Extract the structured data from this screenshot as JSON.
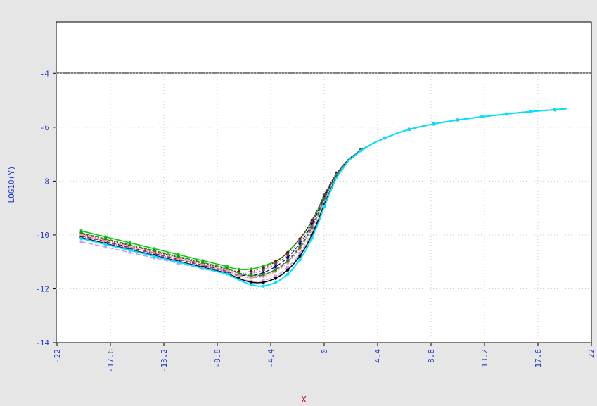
{
  "chart_data": {
    "type": "line",
    "title": "",
    "xlabel": "X",
    "ylabel": "LOG10(Y)",
    "xlim": [
      -22,
      22
    ],
    "ylim": [
      -14,
      -3
    ],
    "xticks": [
      -22,
      -17.6,
      -13.2,
      -8.8,
      -4.4,
      0,
      4.4,
      8.8,
      13.2,
      17.6,
      22
    ],
    "xtick_labels": [
      "-22",
      "-17.6",
      "-13.2",
      "-8.8",
      "-4.4",
      "0",
      "4.4",
      "8.8",
      "13.2",
      "17.6",
      "22"
    ],
    "yticks": [
      -14,
      -12,
      -10,
      -8,
      -6,
      -4
    ],
    "ytick_labels": [
      "-14",
      "-12",
      "-10",
      "-8",
      "-6",
      "-4"
    ],
    "grid": true,
    "legend": "none",
    "x": [
      -20,
      -19,
      -18,
      -17,
      -16,
      -15,
      -14,
      -13,
      -12,
      -11,
      -10,
      -9,
      -8,
      -7.5,
      -7,
      -6.5,
      -6,
      -5.5,
      -5,
      -4.5,
      -4,
      -3.5,
      -3,
      -2.5,
      -2,
      -1.5,
      -1,
      -0.5,
      0,
      0.5,
      1,
      2,
      3,
      4,
      5,
      6,
      7,
      8,
      9,
      10,
      11,
      12,
      13,
      14,
      15,
      16,
      17,
      18,
      19,
      20
    ],
    "series": [
      {
        "color": "#00cc00",
        "marker": "circle",
        "dash": "solid",
        "width": 1.6,
        "values": [
          -9.85,
          -9.96,
          -10.07,
          -10.18,
          -10.29,
          -10.4,
          -10.51,
          -10.62,
          -10.73,
          -10.84,
          -10.95,
          -11.06,
          -11.17,
          -11.24,
          -11.28,
          -11.29,
          -11.27,
          -11.22,
          -11.15,
          -11.07,
          -10.98,
          -10.85,
          -10.65,
          -10.4,
          -10.15,
          -9.85,
          -9.5,
          -9.05,
          -8.55,
          -8.15,
          -7.75,
          -7.2,
          -6.85,
          -6.6,
          -6.4,
          -6.22,
          -6.08,
          -5.97,
          -5.88,
          -5.8,
          -5.73,
          -5.67,
          -5.61,
          -5.56,
          -5.51,
          -5.46,
          -5.42,
          -5.38,
          -5.35,
          -5.31
        ]
      },
      {
        "color": "#8b0000",
        "marker": "circle",
        "dash": "2,2",
        "width": 1.2,
        "values": [
          -9.95,
          -10.06,
          -10.17,
          -10.28,
          -10.39,
          -10.5,
          -10.61,
          -10.72,
          -10.83,
          -10.94,
          -11.05,
          -11.16,
          -11.27,
          -11.33,
          -11.37,
          -11.38,
          -11.36,
          -11.3,
          -11.22,
          -11.12,
          -11.0,
          -10.85,
          -10.66,
          -10.42,
          -10.15,
          -9.83,
          -9.45,
          -9.0,
          -8.5,
          -8.1,
          -7.7,
          -7.18,
          -6.84,
          -6.6,
          -6.4,
          -6.22,
          -6.08,
          -5.97,
          -5.88,
          -5.8,
          -5.73,
          -5.67,
          -5.61,
          -5.56,
          -5.51,
          -5.46,
          -5.42,
          -5.38,
          -5.35,
          -5.31
        ]
      },
      {
        "color": "#555555",
        "marker": "circle",
        "dash": "1,2",
        "width": 1.2,
        "values": [
          -9.98,
          -10.09,
          -10.2,
          -10.31,
          -10.42,
          -10.53,
          -10.64,
          -10.75,
          -10.86,
          -10.97,
          -11.08,
          -11.19,
          -11.3,
          -11.37,
          -11.42,
          -11.44,
          -11.43,
          -11.38,
          -11.3,
          -11.2,
          -11.08,
          -10.93,
          -10.74,
          -10.5,
          -10.22,
          -9.9,
          -9.52,
          -9.06,
          -8.55,
          -8.13,
          -7.72,
          -7.19,
          -6.85,
          -6.6,
          -6.4,
          -6.22,
          -6.08,
          -5.97,
          -5.88,
          -5.8,
          -5.73,
          -5.67,
          -5.61,
          -5.56,
          -5.51,
          -5.46,
          -5.42,
          -5.38,
          -5.35,
          -5.31
        ]
      },
      {
        "color": "#000080",
        "marker": "circle",
        "dash": "6,3",
        "width": 1.2,
        "values": [
          -10.02,
          -10.13,
          -10.24,
          -10.35,
          -10.46,
          -10.57,
          -10.68,
          -10.79,
          -10.9,
          -11.01,
          -11.12,
          -11.23,
          -11.34,
          -11.42,
          -11.48,
          -11.51,
          -11.51,
          -11.47,
          -11.4,
          -11.3,
          -11.18,
          -11.03,
          -10.84,
          -10.6,
          -10.32,
          -10.0,
          -9.6,
          -9.13,
          -8.6,
          -8.17,
          -7.74,
          -7.2,
          -6.85,
          -6.6,
          -6.4,
          -6.22,
          -6.08,
          -5.97,
          -5.88,
          -5.8,
          -5.73,
          -5.67,
          -5.61,
          -5.56,
          -5.51,
          -5.46,
          -5.42,
          -5.38,
          -5.35,
          -5.31
        ]
      },
      {
        "color": "#9932cc",
        "marker": "circle",
        "dash": "4,2,1,2",
        "width": 1.4,
        "values": [
          -10.05,
          -10.16,
          -10.27,
          -10.38,
          -10.49,
          -10.6,
          -10.71,
          -10.82,
          -10.93,
          -11.04,
          -11.15,
          -11.26,
          -11.37,
          -11.46,
          -11.53,
          -11.57,
          -11.58,
          -11.55,
          -11.49,
          -11.4,
          -11.28,
          -11.13,
          -10.94,
          -10.7,
          -10.42,
          -10.09,
          -9.68,
          -9.2,
          -8.65,
          -8.2,
          -7.76,
          -7.21,
          -6.86,
          -6.6,
          -6.4,
          -6.22,
          -6.08,
          -5.97,
          -5.88,
          -5.8,
          -5.73,
          -5.67,
          -5.61,
          -5.56,
          -5.51,
          -5.46,
          -5.42,
          -5.38,
          -5.35,
          -5.31
        ]
      },
      {
        "color": "#ffa07a",
        "marker": "circle",
        "dash": "3,2",
        "width": 1.6,
        "values": [
          -10.0,
          -10.11,
          -10.22,
          -10.33,
          -10.44,
          -10.55,
          -10.66,
          -10.77,
          -10.88,
          -10.99,
          -11.1,
          -11.21,
          -11.32,
          -11.42,
          -11.5,
          -11.56,
          -11.59,
          -11.58,
          -11.54,
          -11.46,
          -11.36,
          -11.22,
          -11.04,
          -10.81,
          -10.53,
          -10.19,
          -9.78,
          -9.28,
          -8.72,
          -8.25,
          -7.79,
          -7.22,
          -6.86,
          -6.6,
          -6.4,
          -6.22,
          -6.08,
          -5.97,
          -5.88,
          -5.8,
          -5.73,
          -5.67,
          -5.61,
          -5.56,
          -5.51,
          -5.46,
          -5.42,
          -5.38,
          -5.35,
          -5.31
        ]
      },
      {
        "color": "#228b22",
        "marker": "circle",
        "dash": "5,2",
        "width": 1.4,
        "values": [
          -9.92,
          -10.03,
          -10.14,
          -10.25,
          -10.36,
          -10.47,
          -10.58,
          -10.69,
          -10.8,
          -10.91,
          -11.02,
          -11.13,
          -11.24,
          -11.34,
          -11.42,
          -11.48,
          -11.51,
          -11.51,
          -11.47,
          -11.4,
          -11.3,
          -11.16,
          -10.98,
          -10.75,
          -10.47,
          -10.13,
          -9.72,
          -9.23,
          -8.68,
          -8.22,
          -7.77,
          -7.21,
          -6.86,
          -6.6,
          -6.4,
          -6.22,
          -6.08,
          -5.97,
          -5.88,
          -5.8,
          -5.73,
          -5.67,
          -5.61,
          -5.56,
          -5.51,
          -5.46,
          -5.42,
          -5.38,
          -5.35,
          -5.31
        ]
      },
      {
        "color": "#cc99ff",
        "marker": "square",
        "dash": "7,3",
        "width": 1.6,
        "values": [
          -10.25,
          -10.35,
          -10.45,
          -10.55,
          -10.65,
          -10.75,
          -10.85,
          -10.95,
          -11.05,
          -11.15,
          -11.25,
          -11.35,
          -11.45,
          -11.54,
          -11.62,
          -11.68,
          -11.72,
          -11.73,
          -11.7,
          -11.63,
          -11.53,
          -11.39,
          -11.2,
          -10.97,
          -10.68,
          -10.33,
          -9.9,
          -9.38,
          -8.8,
          -8.3,
          -7.82,
          -7.23,
          -6.87,
          -6.6,
          -6.4,
          -6.22,
          -6.08,
          -5.97,
          -5.88,
          -5.8,
          -5.73,
          -5.67,
          -5.61,
          -5.56,
          -5.51,
          -5.46,
          -5.42,
          -5.38,
          -5.35,
          -5.31
        ]
      },
      {
        "color": "#000000",
        "marker": "circle",
        "dash": "solid",
        "width": 1.6,
        "values": [
          -10.1,
          -10.21,
          -10.32,
          -10.43,
          -10.54,
          -10.65,
          -10.76,
          -10.87,
          -10.98,
          -11.09,
          -11.2,
          -11.31,
          -11.42,
          -11.52,
          -11.62,
          -11.7,
          -11.76,
          -11.78,
          -11.76,
          -11.7,
          -11.61,
          -11.48,
          -11.3,
          -11.07,
          -10.78,
          -10.43,
          -10.0,
          -9.47,
          -8.88,
          -8.35,
          -7.85,
          -7.24,
          -6.87,
          -6.6,
          -6.4,
          -6.22,
          -6.08,
          -5.97,
          -5.88,
          -5.8,
          -5.73,
          -5.67,
          -5.61,
          -5.56,
          -5.51,
          -5.46,
          -5.42,
          -5.38,
          -5.35,
          -5.31
        ]
      },
      {
        "color": "#00e5ff",
        "marker": "circle",
        "dash": "solid",
        "width": 2.0,
        "values": [
          -10.13,
          -10.24,
          -10.35,
          -10.46,
          -10.57,
          -10.68,
          -10.79,
          -10.9,
          -11.01,
          -11.12,
          -11.23,
          -11.34,
          -11.45,
          -11.56,
          -11.67,
          -11.77,
          -11.85,
          -11.9,
          -11.9,
          -11.85,
          -11.77,
          -11.64,
          -11.46,
          -11.22,
          -10.92,
          -10.56,
          -10.12,
          -9.58,
          -8.96,
          -8.4,
          -7.88,
          -7.25,
          -6.88,
          -6.6,
          -6.4,
          -6.22,
          -6.08,
          -5.97,
          -5.88,
          -5.8,
          -5.73,
          -5.67,
          -5.61,
          -5.56,
          -5.51,
          -5.46,
          -5.42,
          -5.38,
          -5.35,
          -5.31
        ]
      }
    ]
  }
}
